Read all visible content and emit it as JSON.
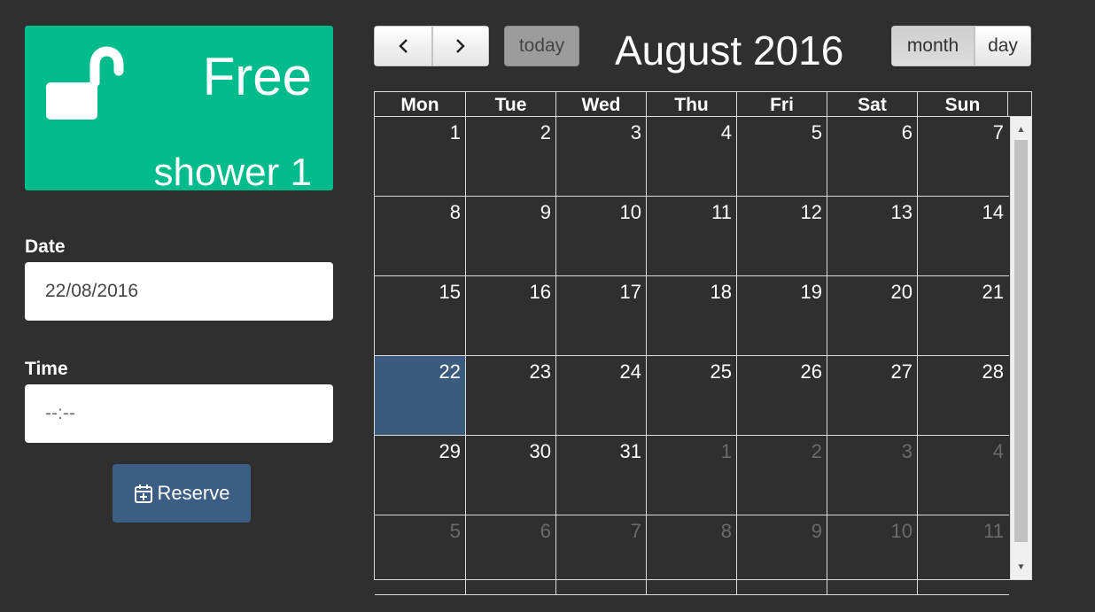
{
  "status": {
    "state": "Free",
    "name": "shower 1",
    "color": "#00bb8b"
  },
  "form": {
    "date_label": "Date",
    "date_value": "22/08/2016",
    "time_label": "Time",
    "time_placeholder": "--:--",
    "reserve_label": "Reserve"
  },
  "calendar": {
    "prev_label": "‹",
    "next_label": "›",
    "today_label": "today",
    "title": "August 2016",
    "view_month_label": "month",
    "view_day_label": "day",
    "active_view": "month",
    "highlight_color": "#3a5a7e",
    "weekdays": [
      "Mon",
      "Tue",
      "Wed",
      "Thu",
      "Fri",
      "Sat",
      "Sun"
    ],
    "weeks": [
      [
        {
          "d": "1",
          "o": false
        },
        {
          "d": "2",
          "o": false
        },
        {
          "d": "3",
          "o": false
        },
        {
          "d": "4",
          "o": false
        },
        {
          "d": "5",
          "o": false
        },
        {
          "d": "6",
          "o": false
        },
        {
          "d": "7",
          "o": false
        }
      ],
      [
        {
          "d": "8",
          "o": false
        },
        {
          "d": "9",
          "o": false
        },
        {
          "d": "10",
          "o": false
        },
        {
          "d": "11",
          "o": false
        },
        {
          "d": "12",
          "o": false
        },
        {
          "d": "13",
          "o": false
        },
        {
          "d": "14",
          "o": false
        }
      ],
      [
        {
          "d": "15",
          "o": false
        },
        {
          "d": "16",
          "o": false
        },
        {
          "d": "17",
          "o": false
        },
        {
          "d": "18",
          "o": false
        },
        {
          "d": "19",
          "o": false
        },
        {
          "d": "20",
          "o": false
        },
        {
          "d": "21",
          "o": false
        }
      ],
      [
        {
          "d": "22",
          "o": false,
          "today": true
        },
        {
          "d": "23",
          "o": false
        },
        {
          "d": "24",
          "o": false
        },
        {
          "d": "25",
          "o": false
        },
        {
          "d": "26",
          "o": false
        },
        {
          "d": "27",
          "o": false
        },
        {
          "d": "28",
          "o": false
        }
      ],
      [
        {
          "d": "29",
          "o": false
        },
        {
          "d": "30",
          "o": false
        },
        {
          "d": "31",
          "o": false
        },
        {
          "d": "1",
          "o": true
        },
        {
          "d": "2",
          "o": true
        },
        {
          "d": "3",
          "o": true
        },
        {
          "d": "4",
          "o": true
        }
      ],
      [
        {
          "d": "5",
          "o": true
        },
        {
          "d": "6",
          "o": true
        },
        {
          "d": "7",
          "o": true
        },
        {
          "d": "8",
          "o": true
        },
        {
          "d": "9",
          "o": true
        },
        {
          "d": "10",
          "o": true
        },
        {
          "d": "11",
          "o": true
        }
      ]
    ]
  },
  "icons": {
    "status": "unlock-icon",
    "reserve": "calendar-plus-icon"
  }
}
